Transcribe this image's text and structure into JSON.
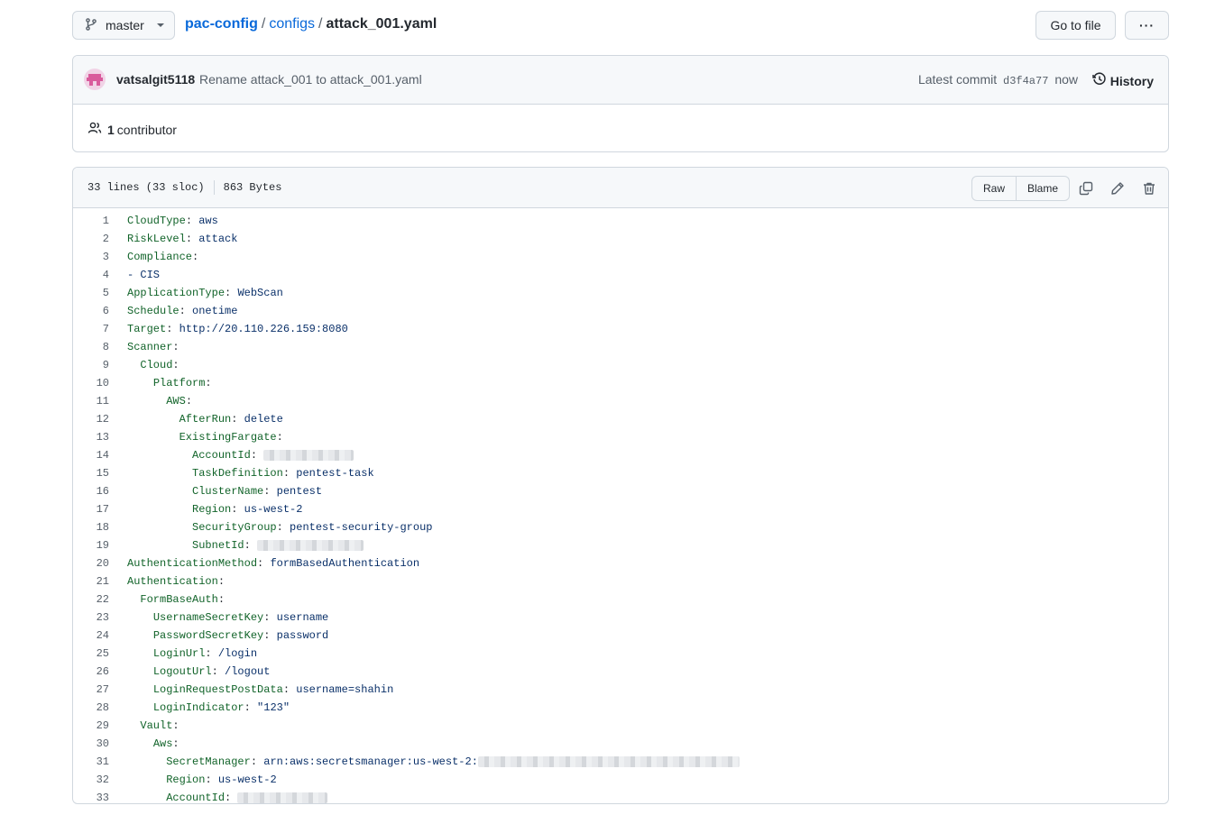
{
  "branch": {
    "name": "master"
  },
  "breadcrumb": {
    "repo": "pac-config",
    "dir": "configs",
    "file": "attack_001.yaml",
    "sep": "/"
  },
  "header_buttons": {
    "goto_file": "Go to file",
    "more": "···"
  },
  "commit": {
    "author": "vatsalgit5118",
    "message": "Rename attack_001 to attack_001.yaml",
    "latest_label": "Latest commit",
    "sha": "d3f4a77",
    "time": "now",
    "history_label": "History"
  },
  "contributors": {
    "count": "1",
    "label": "contributor"
  },
  "file": {
    "lines_info": "33 lines (33 sloc)",
    "size": "863 Bytes",
    "raw_label": "Raw",
    "blame_label": "Blame"
  },
  "code_lines": [
    {
      "n": "1",
      "indent": "",
      "key": "CloudType",
      "val": "aws"
    },
    {
      "n": "2",
      "indent": "",
      "key": "RiskLevel",
      "val": "attack"
    },
    {
      "n": "3",
      "indent": "",
      "key": "Compliance",
      "val": ""
    },
    {
      "n": "4",
      "indent": "",
      "key": "",
      "val": "- CIS"
    },
    {
      "n": "5",
      "indent": "",
      "key": "ApplicationType",
      "val": "WebScan"
    },
    {
      "n": "6",
      "indent": "",
      "key": "Schedule",
      "val": "onetime"
    },
    {
      "n": "7",
      "indent": "",
      "key": "Target",
      "val": "http://20.110.226.159:8080"
    },
    {
      "n": "8",
      "indent": "",
      "key": "Scanner",
      "val": ""
    },
    {
      "n": "9",
      "indent": "  ",
      "key": "Cloud",
      "val": ""
    },
    {
      "n": "10",
      "indent": "    ",
      "key": "Platform",
      "val": ""
    },
    {
      "n": "11",
      "indent": "      ",
      "key": "AWS",
      "val": ""
    },
    {
      "n": "12",
      "indent": "        ",
      "key": "AfterRun",
      "val": "delete"
    },
    {
      "n": "13",
      "indent": "        ",
      "key": "ExistingFargate",
      "val": ""
    },
    {
      "n": "14",
      "indent": "          ",
      "key": "AccountId",
      "val": "",
      "redacted": "short"
    },
    {
      "n": "15",
      "indent": "          ",
      "key": "TaskDefinition",
      "val": "pentest-task"
    },
    {
      "n": "16",
      "indent": "          ",
      "key": "ClusterName",
      "val": "pentest"
    },
    {
      "n": "17",
      "indent": "          ",
      "key": "Region",
      "val": "us-west-2"
    },
    {
      "n": "18",
      "indent": "          ",
      "key": "SecurityGroup",
      "val": "pentest-security-group"
    },
    {
      "n": "19",
      "indent": "          ",
      "key": "SubnetId",
      "val": "",
      "redacted": "medium"
    },
    {
      "n": "20",
      "indent": "",
      "key": "AuthenticationMethod",
      "val": "formBasedAuthentication"
    },
    {
      "n": "21",
      "indent": "",
      "key": "Authentication",
      "val": ""
    },
    {
      "n": "22",
      "indent": "  ",
      "key": "FormBaseAuth",
      "val": ""
    },
    {
      "n": "23",
      "indent": "    ",
      "key": "UsernameSecretKey",
      "val": "username"
    },
    {
      "n": "24",
      "indent": "    ",
      "key": "PasswordSecretKey",
      "val": "password"
    },
    {
      "n": "25",
      "indent": "    ",
      "key": "LoginUrl",
      "val": "/login"
    },
    {
      "n": "26",
      "indent": "    ",
      "key": "LogoutUrl",
      "val": "/logout"
    },
    {
      "n": "27",
      "indent": "    ",
      "key": "LoginRequestPostData",
      "val": "username=shahin"
    },
    {
      "n": "28",
      "indent": "    ",
      "key": "LoginIndicator",
      "val": "\"123\""
    },
    {
      "n": "29",
      "indent": "  ",
      "key": "Vault",
      "val": ""
    },
    {
      "n": "30",
      "indent": "    ",
      "key": "Aws",
      "val": ""
    },
    {
      "n": "31",
      "indent": "      ",
      "key": "SecretManager",
      "val": "arn:aws:secretsmanager:us-west-2:",
      "redacted": "long"
    },
    {
      "n": "32",
      "indent": "      ",
      "key": "Region",
      "val": "us-west-2"
    },
    {
      "n": "33",
      "indent": "      ",
      "key": "AccountId",
      "val": "",
      "redacted": "short"
    }
  ]
}
